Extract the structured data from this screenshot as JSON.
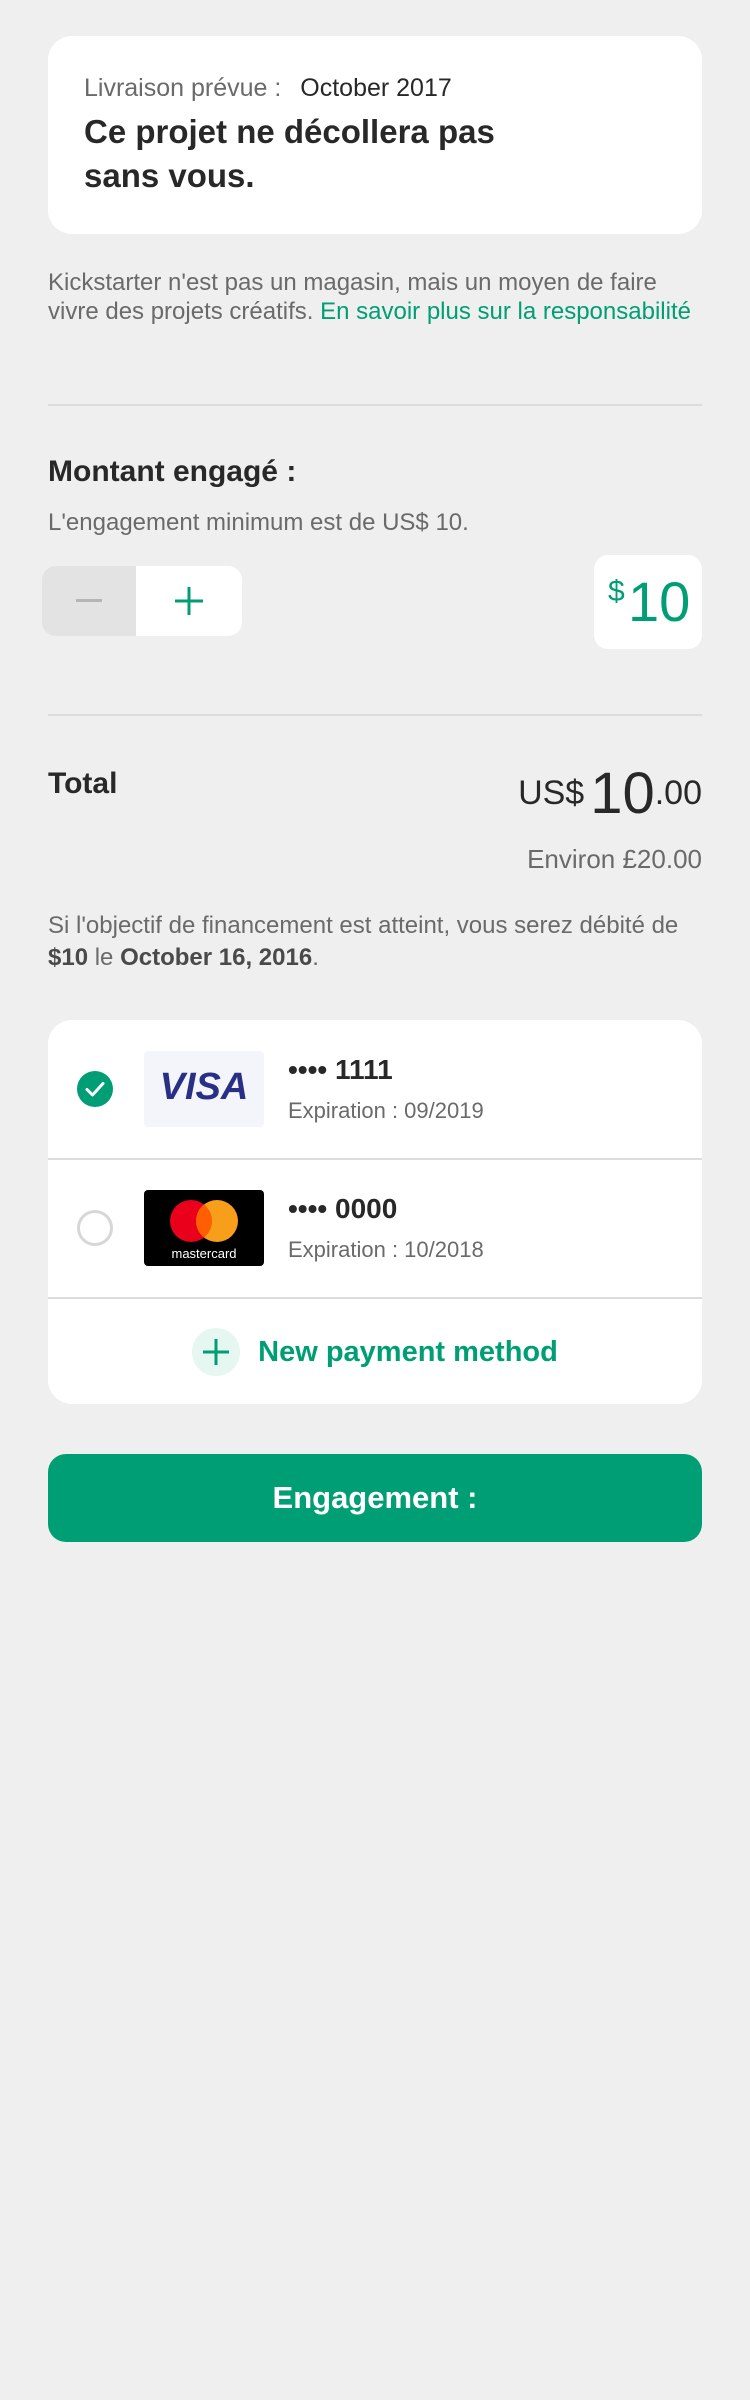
{
  "delivery": {
    "label": "Livraison prévue :",
    "date": "October 2017",
    "title": "Ce projet ne décollera pas sans vous."
  },
  "info": {
    "text": "Kickstarter n'est pas un magasin, mais un moyen de faire vivre des projets créatifs.",
    "link": "En savoir plus sur la responsabilité"
  },
  "pledge": {
    "title": "Montant engagé :",
    "minimum_text": "L'engagement minimum est de US$ 10.",
    "currency_symbol": "$",
    "amount": "10"
  },
  "total": {
    "label": "Total",
    "currency": "US$",
    "amount_main": "10",
    "amount_cents": ".00",
    "approx": "Environ £20.00"
  },
  "charge": {
    "prefix": "Si l'objectif de financement est atteint, vous serez débité de",
    "amount": "$10",
    "middle": "le",
    "date": "October 16, 2016",
    "suffix": "."
  },
  "payment_methods": [
    {
      "brand": "VISA",
      "number": "•••• 1111",
      "expiry": "Expiration : 09/2019",
      "selected": true,
      "icon": "visa-logo"
    },
    {
      "brand": "mastercard",
      "number": "•••• 0000",
      "expiry": "Expiration : 10/2018",
      "selected": false,
      "icon": "mastercard-logo"
    }
  ],
  "new_payment": {
    "label": "New payment method",
    "icon": "plus-icon"
  },
  "engage_button": {
    "label": "Engagement :"
  },
  "colors": {
    "accent": "#009e74",
    "background": "#efefef",
    "text": "#282828",
    "muted_text": "#6a6a6a",
    "visa_blue": "#1a1f71",
    "mc_red": "#eb001b",
    "mc_orange": "#f79e1b"
  }
}
